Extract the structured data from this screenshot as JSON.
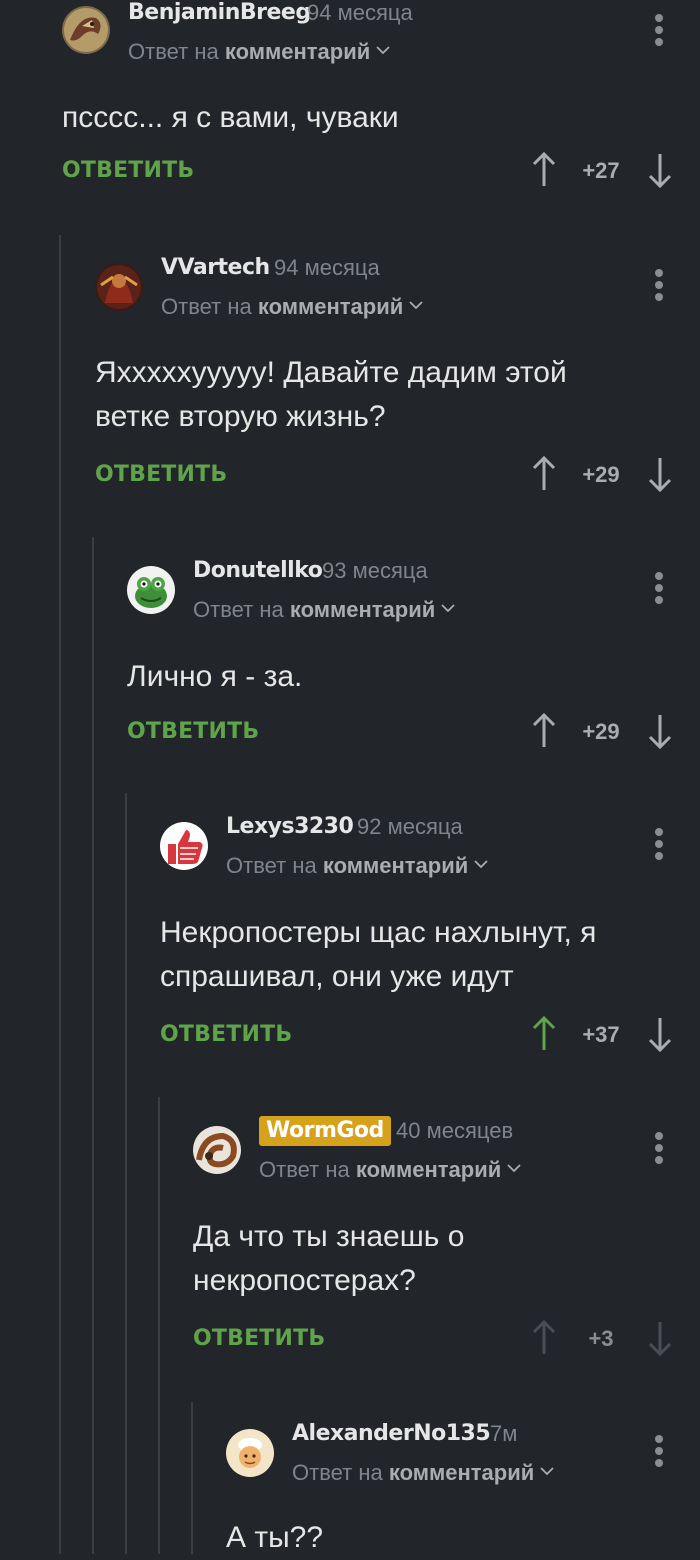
{
  "reply_label": "ОТВЕТИТЬ",
  "comments": [
    {
      "author": "BenjaminBreeg",
      "time": "94 месяца",
      "reply_prefix": "Ответ на",
      "reply_target": "комментарий",
      "text_lines": [
        "псссс... я с вами, чуваки"
      ],
      "score": "+27",
      "avatar_icon": "avatar-dragon",
      "upvoted": false,
      "dimmed": false
    },
    {
      "author": "VVartech",
      "time": "94 месяца",
      "reply_prefix": "Ответ на",
      "reply_target": "комментарий",
      "text_lines": [
        "Яхххххууууу! Давайте дадим этой",
        "ветке вторую жизнь?"
      ],
      "score": "+29",
      "avatar_icon": "avatar-warrior",
      "upvoted": false,
      "dimmed": false
    },
    {
      "author": "Donutellko",
      "time": "93 месяца",
      "reply_prefix": "Ответ на",
      "reply_target": "комментарий",
      "text_lines": [
        "Лично я - за."
      ],
      "score": "+29",
      "avatar_icon": "avatar-frog",
      "upvoted": false,
      "dimmed": false
    },
    {
      "author": "Lexys3230",
      "time": "92 месяца",
      "reply_prefix": "Ответ на",
      "reply_target": "комментарий",
      "text_lines": [
        "Некропостеры щас нахлынут, я",
        "спрашивал, они уже идут"
      ],
      "score": "+37",
      "avatar_icon": "avatar-thumbs-up",
      "upvoted": true,
      "dimmed": false
    },
    {
      "author": "WormGod",
      "time": "40 месяцев",
      "reply_prefix": "Ответ на",
      "reply_target": "комментарий",
      "text_lines": [
        "Да что ты знаешь о",
        "некропостерах?"
      ],
      "score": "+3",
      "avatar_icon": "avatar-worm",
      "upvoted": false,
      "dimmed": true,
      "badge": true
    },
    {
      "author": "AlexanderNo135",
      "time": "7м",
      "reply_prefix": "Ответ на",
      "reply_target": "комментарий",
      "text_lines": [
        "А ты??"
      ],
      "score": "",
      "avatar_icon": "avatar-chef",
      "upvoted": false,
      "dimmed": false
    }
  ],
  "colors": {
    "background": "#222529",
    "accent_green": "#5fa34a",
    "badge_gold": "#d6a21c",
    "muted": "#80858c"
  }
}
